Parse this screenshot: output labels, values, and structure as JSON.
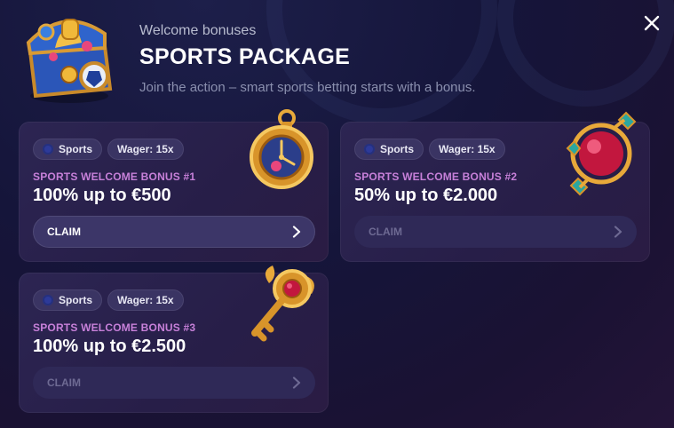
{
  "header": {
    "subtitle": "Welcome bonuses",
    "title": "SPORTS PACKAGE",
    "description": "Join the action – smart sports betting starts with a bonus."
  },
  "icons": {
    "close": "close-icon",
    "chest": "treasure-chest-icon",
    "chevron": "chevron-right-icon"
  },
  "bonuses": [
    {
      "sport_tag": "Sports",
      "wager_tag": "Wager: 15x",
      "label": "SPORTS WELCOME BONUS #1",
      "title": "100% up to €500",
      "claim_label": "CLAIM",
      "claim_state": "active",
      "art": "pocket-watch-icon"
    },
    {
      "sport_tag": "Sports",
      "wager_tag": "Wager: 15x",
      "label": "SPORTS WELCOME BONUS #2",
      "title": "50% up to €2.000",
      "claim_label": "CLAIM",
      "claim_state": "disabled",
      "art": "ruby-amulet-icon"
    },
    {
      "sport_tag": "Sports",
      "wager_tag": "Wager: 15x",
      "label": "SPORTS WELCOME BONUS #3",
      "title": "100% up to €2.500",
      "claim_label": "CLAIM",
      "claim_state": "disabled",
      "art": "golden-key-icon"
    }
  ],
  "colors": {
    "background": "#15153a",
    "card": "#2c2552",
    "bonus_label": "#c780d9",
    "claim_active": "#3c3668",
    "claim_disabled_text": "#6e6a93"
  }
}
